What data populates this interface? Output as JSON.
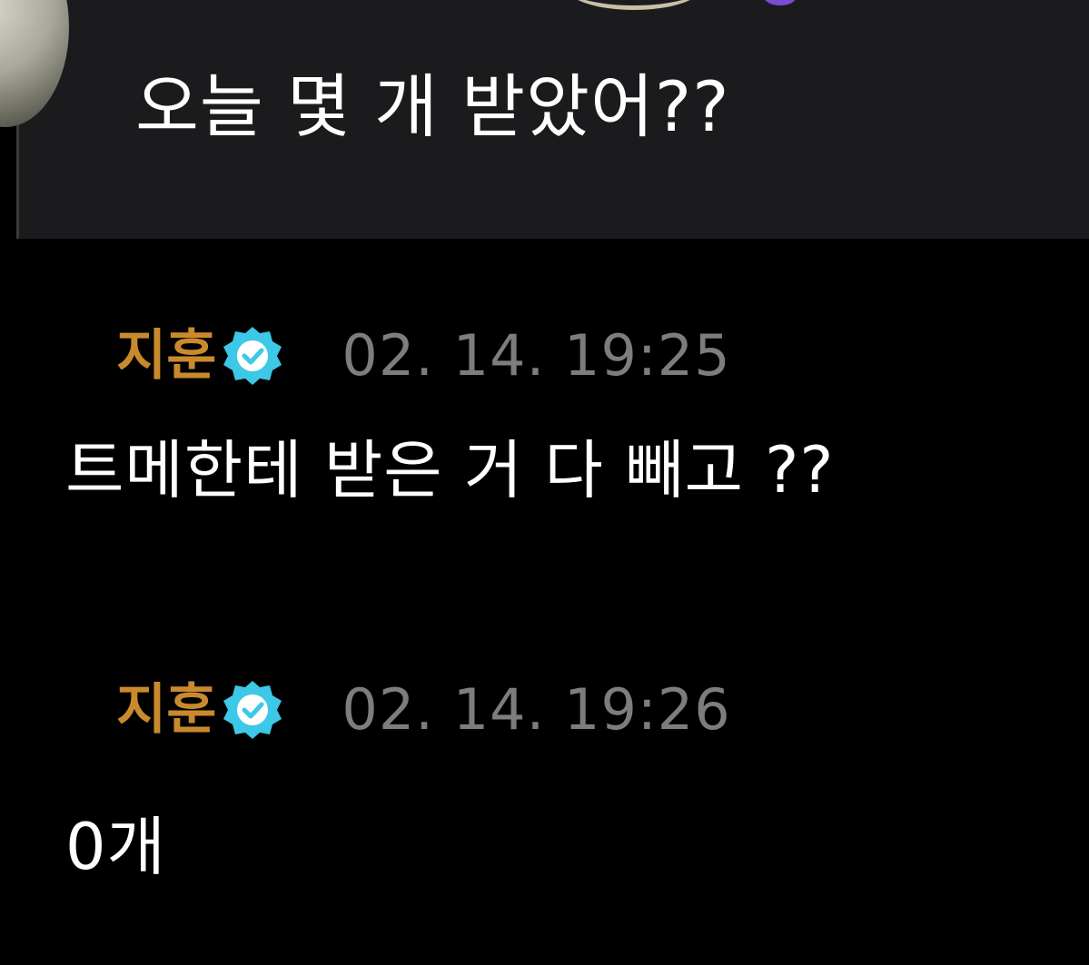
{
  "quoted_message": {
    "text": "오늘 몇 개 받았어??"
  },
  "messages": [
    {
      "author": "지훈",
      "timestamp": "02. 14. 19:25",
      "text": "트메한테 받은 거 다 빼고 ??"
    },
    {
      "author": "지훈",
      "timestamp": "02. 14. 19:26",
      "text": "0개"
    }
  ],
  "colors": {
    "background": "#000000",
    "quote_background": "#1b1b1d",
    "author": "#c98a2e",
    "timestamp": "#7d7d7d",
    "verified_badge": "#3cc8e6",
    "text": "#ffffff"
  },
  "icons": {
    "verified": "verified-badge-icon"
  }
}
